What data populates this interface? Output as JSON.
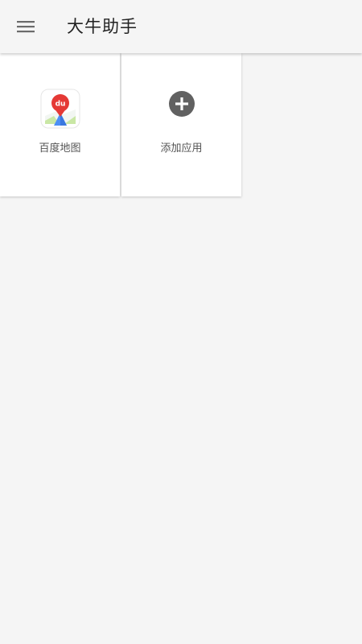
{
  "app_bar": {
    "title": "大牛助手",
    "menu_icon": "hamburger-menu-icon"
  },
  "apps": [
    {
      "label": "百度地图",
      "icon": "baidu-map-icon"
    },
    {
      "label": "添加应用",
      "icon": "add-circle-icon"
    }
  ],
  "colors": {
    "background": "#f5f5f5",
    "tile": "#ffffff",
    "title_text": "#222222",
    "label_text": "#555555",
    "icon_gray": "#616161",
    "map_pin_red": "#e53935"
  }
}
